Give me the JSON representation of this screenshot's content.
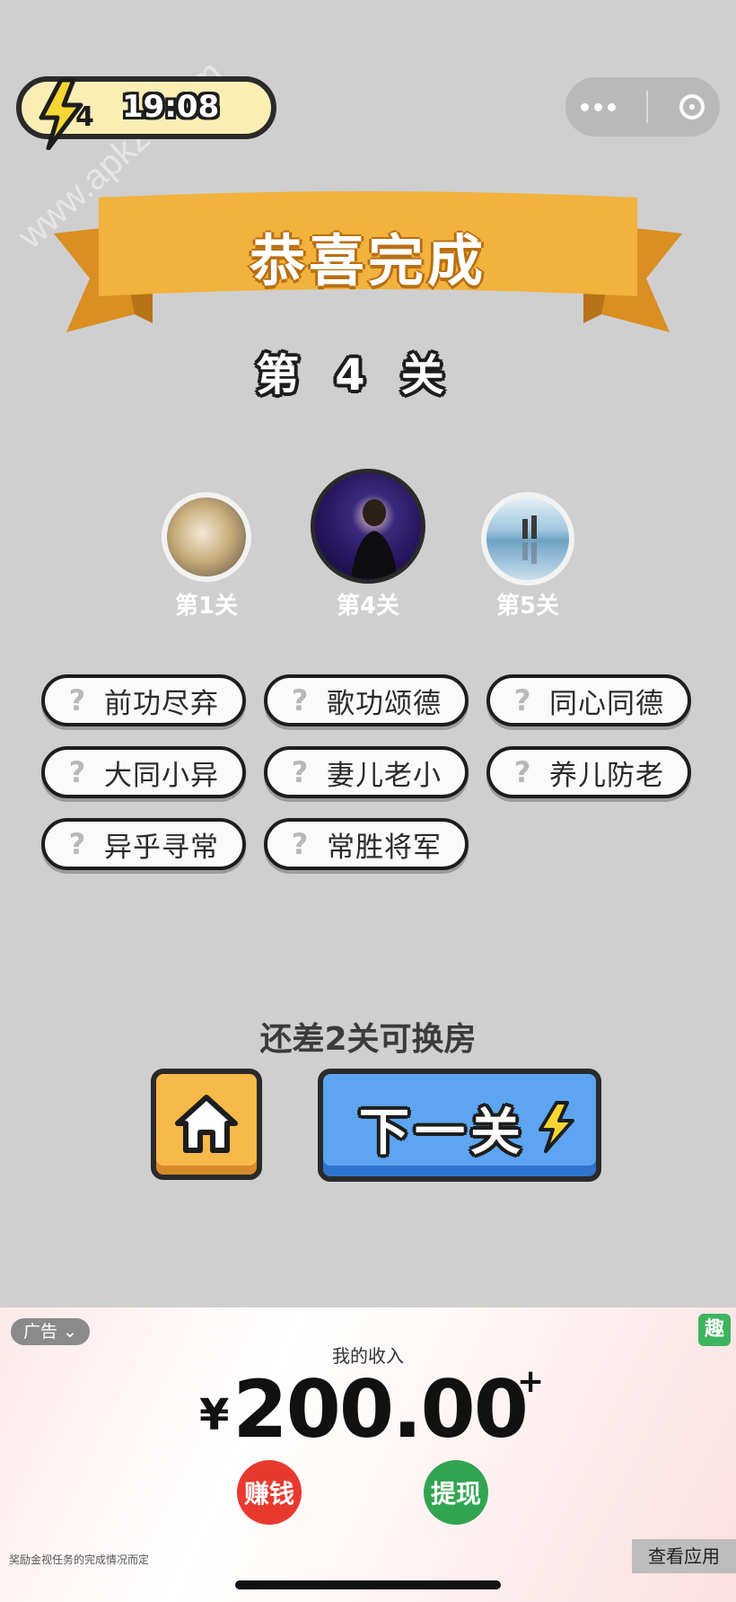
{
  "status": {
    "energy_count": "4",
    "time": "19:08"
  },
  "banner": {
    "title": "恭喜完成",
    "colors": {
      "ribbon": "#f2b23d",
      "ribbon_dark": "#d98f22"
    }
  },
  "level": {
    "title": "第4关",
    "thumbnails": [
      {
        "label": "第1关",
        "icon": "moon-thumbnail"
      },
      {
        "label": "第4关",
        "icon": "concert-singer-thumbnail",
        "current": true
      },
      {
        "label": "第5关",
        "icon": "reflection-landscape-thumbnail"
      }
    ]
  },
  "idioms": [
    "前功尽弃",
    "歌功颂德",
    "同心同德",
    "大同小异",
    "妻儿老小",
    "养儿防老",
    "异乎寻常",
    "常胜将军"
  ],
  "hint_icon": "?",
  "progress": {
    "remaining_text": "还差2关可换房"
  },
  "buttons": {
    "next_label": "下一关"
  },
  "ad": {
    "tag": "广告",
    "badge": "趣",
    "income_label": "我的收入",
    "currency": "¥",
    "amount": "200.00",
    "plus": "+",
    "earn_label": "赚钱",
    "withdraw_label": "提现",
    "note": "奖励金视任务的完成情况而定",
    "view_app": "查看应用",
    "colors": {
      "earn": "#e8392f",
      "withdraw": "#33a552"
    }
  },
  "watermark": "www.apkzu.com"
}
